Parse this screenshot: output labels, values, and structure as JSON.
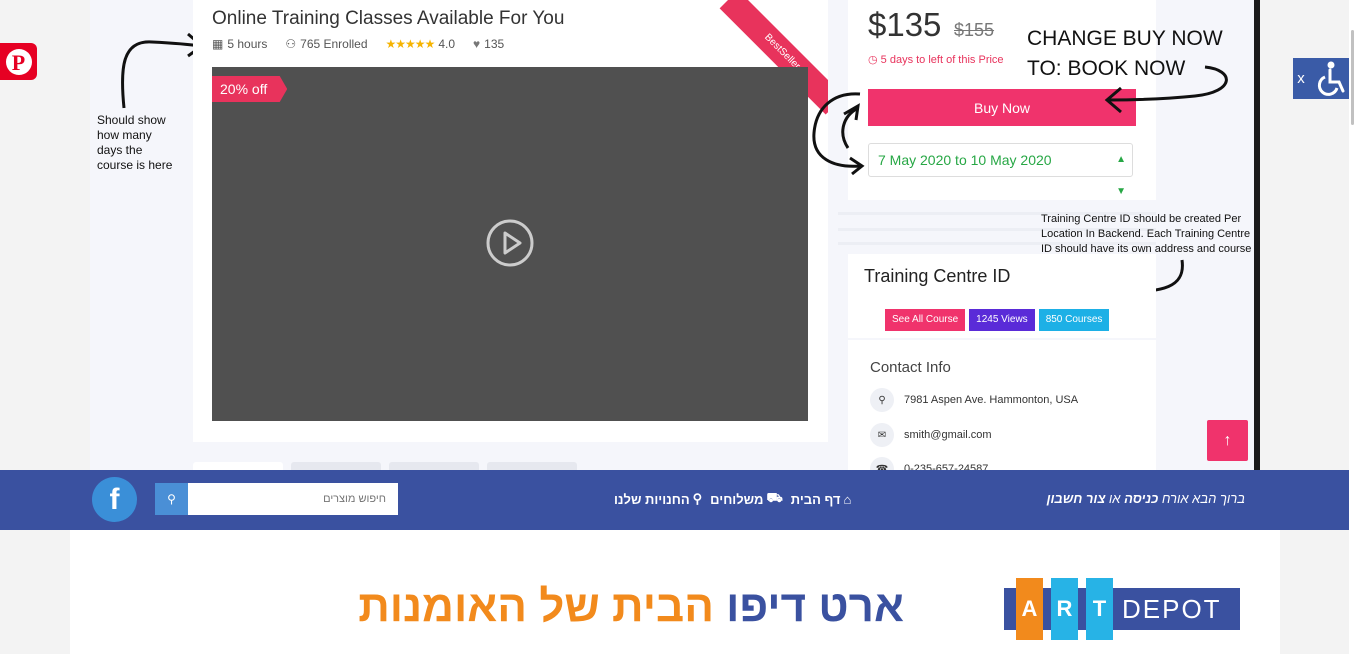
{
  "course": {
    "title": "Online Training Classes Available For You",
    "hours": "5 hours",
    "enrolled": "765 Enrolled",
    "rating": "4.0",
    "likes": "135",
    "ribbon": "BestSeller",
    "discount_badge": "20% off"
  },
  "pricing": {
    "price": "$135",
    "old_price": "$155",
    "days_left": "5 days to left of this Price",
    "buy_button": "Buy Now",
    "date_range": "7 May 2020 to 10 May 2020"
  },
  "annotations": {
    "left_note": "Should show how many days the course is here",
    "change_note_line1": "CHANGE BUY NOW",
    "change_note_line2": "TO: BOOK NOW",
    "centre_note": "Training Centre ID should be created Per Location In Backend. Each Training Centre ID should have its own address and course listings"
  },
  "training_centre": {
    "title": "Training Centre ID",
    "buttons": [
      {
        "label": "See All Course",
        "color": "#f0336c"
      },
      {
        "label": "1245 Views",
        "color": "#5a2bd8"
      },
      {
        "label": "850 Courses",
        "color": "#1db0e6"
      }
    ]
  },
  "contact": {
    "title": "Contact Info",
    "address": "7981 Aspen Ave. Hammonton, USA",
    "email": "smith@gmail.com",
    "phone": "0-235-657-24587"
  },
  "navbar": {
    "welcome_prefix": "ברוך הבא אורח",
    "login": "כניסה",
    "or": "או",
    "create_account": "צור חשבון",
    "menu": [
      "דף הבית",
      "משלוחים",
      "החנויות שלנו"
    ],
    "search_placeholder": "חיפוש מוצרים",
    "facebook": "f"
  },
  "brand": {
    "name_part1": "ארט דיפו",
    "name_part2": "הבית של האומנות",
    "logo_letters": [
      "A",
      "R",
      "T"
    ],
    "logo_word": "DEPOT"
  },
  "colors": {
    "accent_pink": "#f0336c",
    "nav_blue": "#3a51a0",
    "brand_orange": "#f28a1c"
  }
}
